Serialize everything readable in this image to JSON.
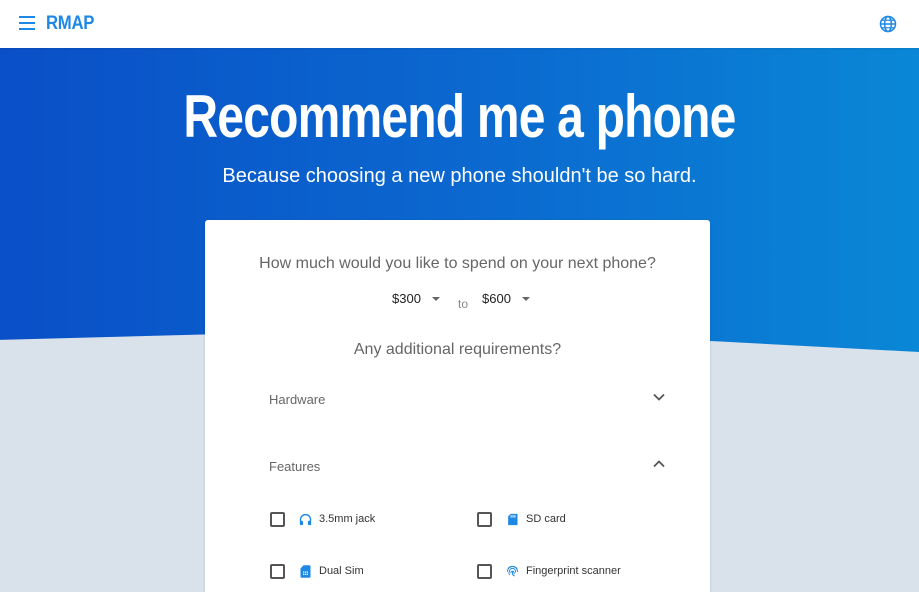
{
  "header": {
    "brand": "RMAP",
    "menu_icon": "menu-icon",
    "language_icon": "globe-icon",
    "accent_color": "#1e88e5"
  },
  "hero": {
    "title": "Recommend me a phone",
    "subtitle": "Because choosing a new phone shouldn't be so hard.",
    "gradient_start": "#0a4fc7",
    "gradient_end": "#0a87d6"
  },
  "card": {
    "budget_question": "How much would you like to spend on your next phone?",
    "price_min": "$300",
    "to_label": "to",
    "price_max": "$600",
    "requirements_question": "Any additional requirements?",
    "sections": [
      {
        "label": "Hardware",
        "state": "collapsed",
        "icon": "chevron-down-icon"
      },
      {
        "label": "Features",
        "state": "expanded",
        "icon": "chevron-up-icon"
      }
    ],
    "features": [
      {
        "label": "3.5mm jack",
        "icon": "headphones-icon",
        "checked": false
      },
      {
        "label": "SD card",
        "icon": "sd-card-icon",
        "checked": false
      },
      {
        "label": "Dual Sim",
        "icon": "sim-card-icon",
        "checked": false
      },
      {
        "label": "Fingerprint scanner",
        "icon": "fingerprint-icon",
        "checked": false
      }
    ]
  }
}
